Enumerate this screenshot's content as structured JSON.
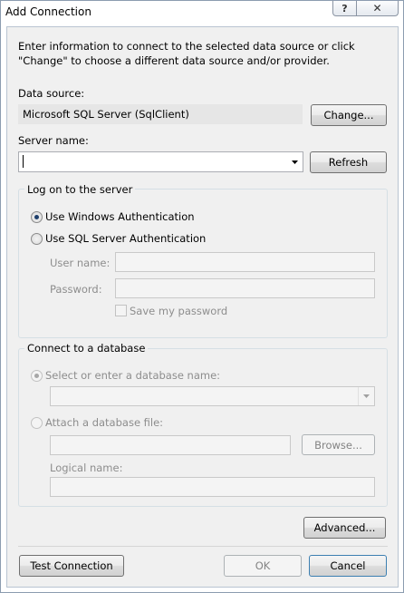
{
  "window": {
    "title": "Add Connection"
  },
  "intro": {
    "text": "Enter information to connect to the selected data source or click \"Change\" to choose a different data source and/or provider."
  },
  "data_source": {
    "label": "Data source:",
    "value": "Microsoft SQL Server (SqlClient)",
    "change_label": "Change..."
  },
  "server": {
    "label": "Server name:",
    "value": "",
    "refresh_label": "Refresh"
  },
  "logon": {
    "group_title": "Log on to the server",
    "windows_auth_label": "Use Windows Authentication",
    "sql_auth_label": "Use SQL Server Authentication",
    "selected": "windows",
    "user_name_label": "User name:",
    "password_label": "Password:",
    "save_password_label": "Save my password"
  },
  "database": {
    "group_title": "Connect to a database",
    "select_db_label": "Select or enter a database name:",
    "attach_file_label": "Attach a database file:",
    "browse_label": "Browse...",
    "logical_name_label": "Logical name:"
  },
  "footer": {
    "advanced_label": "Advanced...",
    "test_connection_label": "Test Connection",
    "ok_label": "OK",
    "cancel_label": "Cancel"
  },
  "icons": {
    "help": "question-mark",
    "close": "x",
    "dropdown": "triangle-down"
  }
}
